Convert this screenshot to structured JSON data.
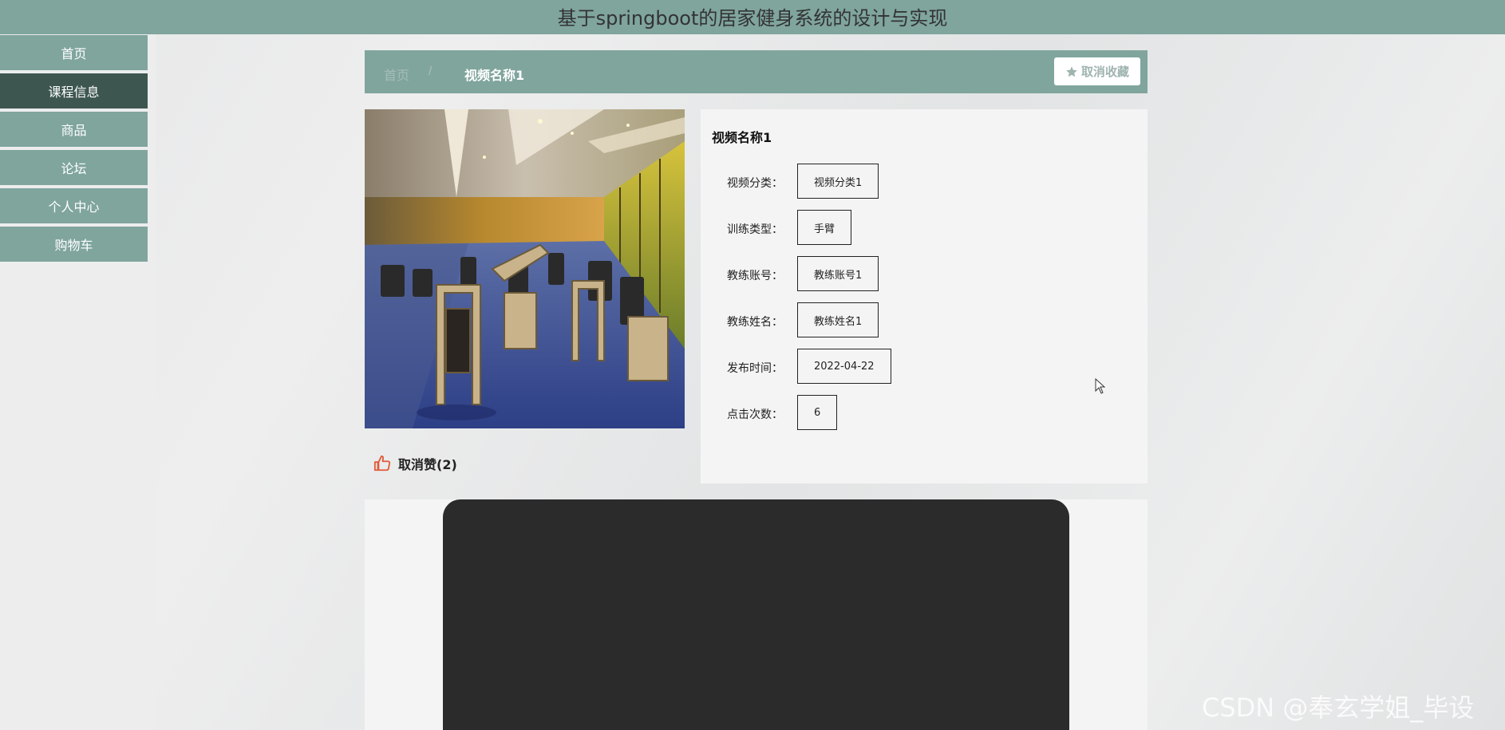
{
  "app": {
    "title": "基于springboot的居家健身系统的设计与实现"
  },
  "sidebar": {
    "items": [
      {
        "label": "首页",
        "active": false
      },
      {
        "label": "课程信息",
        "active": true
      },
      {
        "label": "商品",
        "active": false
      },
      {
        "label": "论坛",
        "active": false
      },
      {
        "label": "个人中心",
        "active": false
      },
      {
        "label": "购物车",
        "active": false
      }
    ]
  },
  "breadcrumb": {
    "home": "首页",
    "separator": "/",
    "current": "视频名称1"
  },
  "actions": {
    "favorite_label": "取消收藏",
    "like_label": "取消赞(2)"
  },
  "detail": {
    "title": "视频名称1",
    "fields": [
      {
        "label": "视频分类：",
        "value": "视频分类1"
      },
      {
        "label": "训练类型：",
        "value": "手臂"
      },
      {
        "label": "教练账号：",
        "value": "教练账号1"
      },
      {
        "label": "教练姓名：",
        "value": "教练姓名1"
      },
      {
        "label": "发布时间：",
        "value": "2022-04-22"
      },
      {
        "label": "点击次数：",
        "value": "6"
      }
    ]
  },
  "watermark": "CSDN @奉玄学姐_毕设",
  "colors": {
    "primary": "#7fa59d",
    "active_nav": "#3d5650",
    "like_icon": "#e05a3a"
  },
  "icons": {
    "favorite": "star-icon",
    "like": "thumbs-up-icon"
  }
}
